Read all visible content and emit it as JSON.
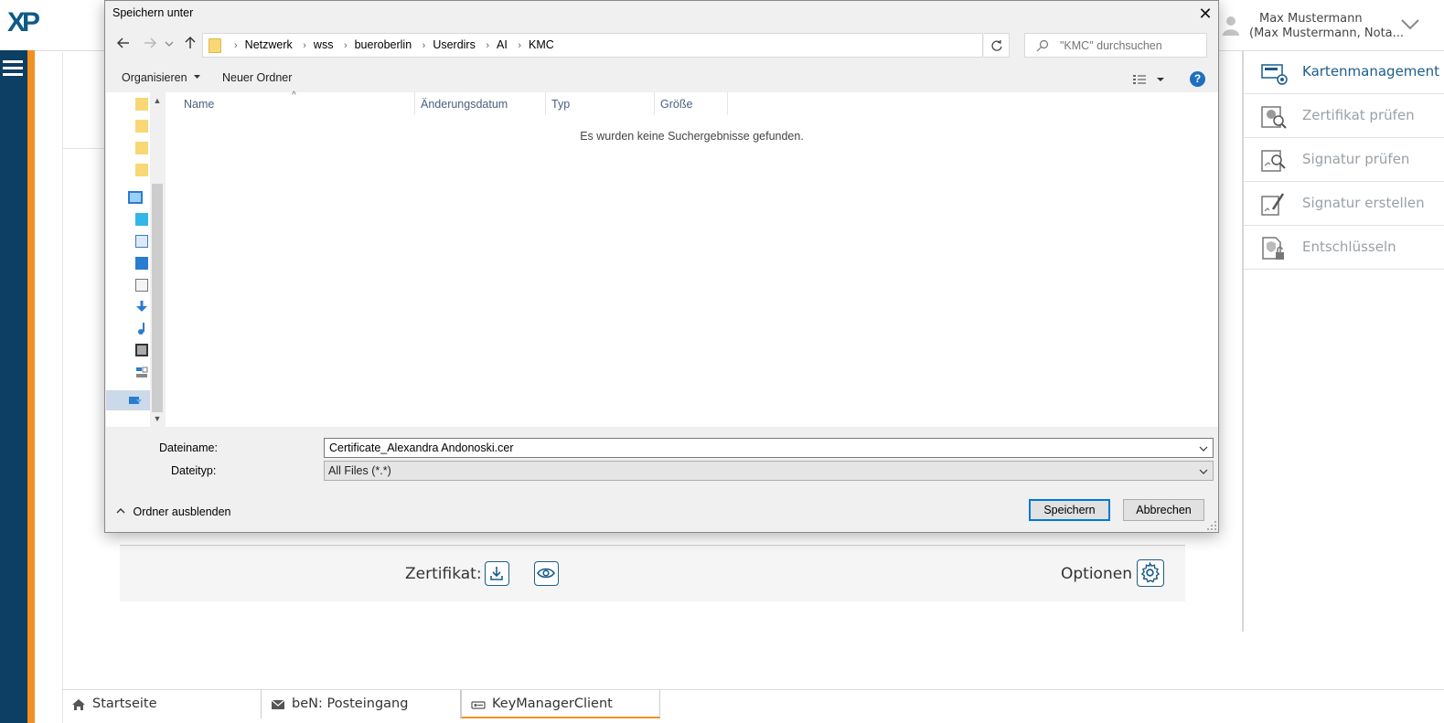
{
  "app": {
    "logo_text": "XP",
    "user": {
      "name": "Max Mustermann",
      "subtitle": "(Max Mustermann, Nota..."
    },
    "right_panel": [
      {
        "label": "Kartenmanagement",
        "icon": "card-icon",
        "active": true
      },
      {
        "label": "Zertifikat prüfen",
        "icon": "certificate-check-icon",
        "active": false
      },
      {
        "label": "Signatur prüfen",
        "icon": "signature-check-icon",
        "active": false
      },
      {
        "label": "Signatur erstellen",
        "icon": "signature-create-icon",
        "active": false
      },
      {
        "label": "Entschlüsseln",
        "icon": "decrypt-icon",
        "active": false
      }
    ],
    "certificate_bar": {
      "label": "Zertifikat:",
      "options_label": "Optionen"
    },
    "tabs": [
      {
        "label": "Startseite",
        "icon": "home-icon"
      },
      {
        "label": "beN: Posteingang",
        "icon": "mail-icon"
      },
      {
        "label": "KeyManagerClient",
        "icon": "key-manager-icon",
        "active": true
      }
    ],
    "colors": {
      "brand_dark": "#0d3e63",
      "accent_orange": "#f39021",
      "active_blue": "#1c5d8a"
    }
  },
  "dialog": {
    "title": "Speichern unter",
    "breadcrumb": [
      "Netzwerk",
      "wss",
      "bueroberlin",
      "Userdirs",
      "AI",
      "KMC"
    ],
    "search_placeholder": "\"KMC\" durchsuchen",
    "toolbar": {
      "organize": "Organisieren",
      "new_folder": "Neuer Ordner"
    },
    "columns": [
      "Name",
      "Änderungsdatum",
      "Typ",
      "Größe"
    ],
    "empty_message": "Es wurden keine Suchergebnisse gefunden.",
    "filename_label": "Dateiname:",
    "filename_value": "Certificate_Alexandra Andonoski.cer",
    "filetype_label": "Dateityp:",
    "filetype_value": "All Files (*.*)",
    "hide_folders": "Ordner ausblenden",
    "save_button": "Speichern",
    "cancel_button": "Abbrechen",
    "help_glyph": "?",
    "close_glyph": "✕"
  }
}
